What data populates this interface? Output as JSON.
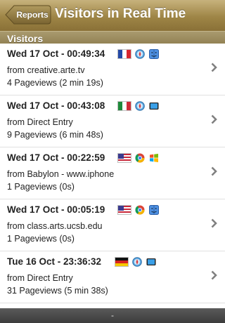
{
  "navbar": {
    "back_label": "Reports",
    "title": "Visitors in Real Time"
  },
  "section": {
    "title": "Visitors"
  },
  "visitors": [
    {
      "time": "Wed 17 Oct - 00:49:34",
      "source": "from creative.arte.tv",
      "pageviews": "4 Pageviews (2 min 19s)",
      "flag": "france",
      "icons": [
        "safari-icon",
        "macos-finder-icon"
      ]
    },
    {
      "time": "Wed 17 Oct - 00:43:08",
      "source": "from Direct Entry",
      "pageviews": "9 Pageviews (6 min 48s)",
      "flag": "italy",
      "icons": [
        "safari-icon",
        "ipad-icon"
      ]
    },
    {
      "time": "Wed 17 Oct - 00:22:59",
      "source": "from Babylon - www.iphone",
      "pageviews": "1 Pageviews (0s)",
      "flag": "usa",
      "icons": [
        "chrome-icon",
        "windows-icon"
      ]
    },
    {
      "time": "Wed 17 Oct - 00:05:19",
      "source": "from class.arts.ucsb.edu",
      "pageviews": "1 Pageviews (0s)",
      "flag": "usa",
      "icons": [
        "chrome-icon",
        "macos-finder-icon"
      ]
    },
    {
      "time": "Tue 16 Oct - 23:36:32",
      "source": "from Direct Entry",
      "pageviews": "31 Pageviews (5 min 38s)",
      "flag": "germany",
      "icons": [
        "safari-icon",
        "ipad-icon"
      ]
    }
  ],
  "toolbar": {
    "label": "-"
  },
  "colors": {
    "navbar": "#9e8546",
    "section_header": "#8f7e50",
    "toolbar": "#3c3c3c"
  }
}
